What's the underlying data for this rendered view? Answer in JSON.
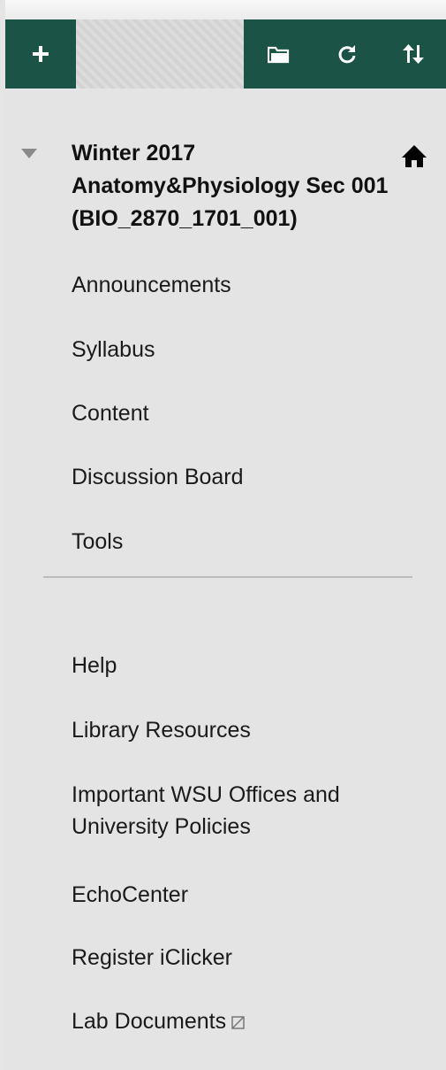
{
  "toolbar": {
    "add_icon": "plus-icon",
    "folder_icon": "folder-icon",
    "refresh_icon": "refresh-icon",
    "sort_icon": "sort-icon",
    "color": "#1b5447"
  },
  "course": {
    "title": "Winter 2017 Anatomy&Physiology Sec 001 (BIO_2870_1701_001)",
    "collapse_icon": "triangle-down-icon",
    "home_icon": "home-icon"
  },
  "menu": {
    "primary": [
      "Announcements",
      "Syllabus",
      "Content",
      "Discussion Board",
      "Tools"
    ],
    "secondary": [
      "Help",
      "Library Resources",
      "Important WSU Offices and University Policies",
      "EchoCenter",
      "Register iClicker",
      "Lab Documents"
    ],
    "lab_documents_icon": "hidden-from-students-icon"
  }
}
